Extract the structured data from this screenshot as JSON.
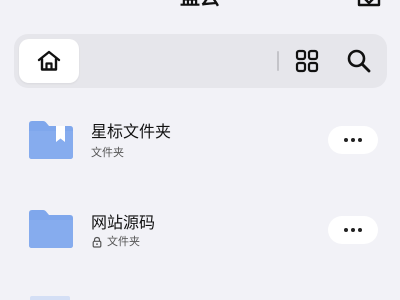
{
  "header": {
    "title": "盘云",
    "menu_icon": "menu-icon",
    "upload_icon": "download-tray-icon"
  },
  "toolbar": {
    "home_icon": "home-icon",
    "grid_icon": "grid-view-icon",
    "search_icon": "search-icon"
  },
  "files": [
    {
      "name": "星标文件夹",
      "type_label": "文件夹",
      "icon": "starred-folder-icon",
      "locked": false
    },
    {
      "name": "网站源码",
      "type_label": "文件夹",
      "icon": "folder-icon",
      "locked": true
    }
  ],
  "colors": {
    "background": "#f2f2f7",
    "toolbar": "#e6e6eb",
    "folder": "#7fa7ec",
    "folder_dark": "#6e98e4"
  }
}
